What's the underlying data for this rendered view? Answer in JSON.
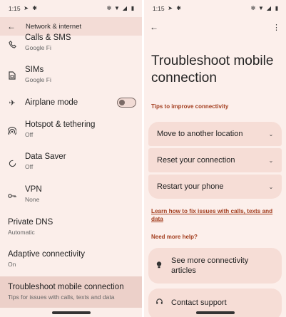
{
  "left": {
    "status": {
      "time": "1:15"
    },
    "appbar": {
      "title": "Network & internet"
    },
    "items": [
      {
        "title": "Calls & SMS",
        "subtitle": "Google Fi",
        "icon": "calls-icon"
      },
      {
        "title": "SIMs",
        "subtitle": "Google Fi",
        "icon": "sim-icon"
      },
      {
        "title": "Airplane mode",
        "icon": "airplane-icon",
        "toggle": "off"
      },
      {
        "title": "Hotspot & tethering",
        "subtitle": "Off",
        "icon": "hotspot-icon"
      },
      {
        "title": "Data Saver",
        "subtitle": "Off",
        "icon": "data-saver-icon"
      },
      {
        "title": "VPN",
        "subtitle": "None",
        "icon": "vpn-icon"
      },
      {
        "title": "Private DNS",
        "subtitle": "Automatic"
      },
      {
        "title": "Adaptive connectivity",
        "subtitle": "On"
      },
      {
        "title": "Troubleshoot mobile connection",
        "subtitle": "Tips for issues with calls, texts and data"
      }
    ]
  },
  "right": {
    "status": {
      "time": "1:15"
    },
    "title": "Troubleshoot mobile connection",
    "tips_heading": "Tips to improve connectivity",
    "tips": [
      "Move to another location",
      "Reset your connection",
      "Restart your phone"
    ],
    "link": "Learn how to fix issues with calls, texts and data",
    "help_heading": "Need more help?",
    "help": [
      {
        "label": "See more connectivity articles",
        "icon": "lightbulb-icon"
      },
      {
        "label": "Contact support",
        "icon": "support-icon"
      }
    ]
  },
  "colors": {
    "accent": "#a33f20",
    "highlight": "#ecd0c9",
    "card": "#f6ddd6"
  }
}
